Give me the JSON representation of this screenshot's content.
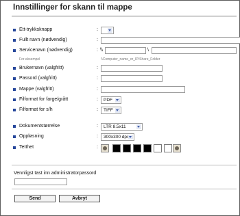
{
  "page": {
    "title": "Innstillinger for skann til mappe"
  },
  "fields": {
    "quick_key": {
      "label": "Ett-trykksknapp",
      "value": ""
    },
    "full_name": {
      "label": "Fullt navn (nødvendig)",
      "value": ""
    },
    "service_name": {
      "label": "Servicenavn (nødvendig)",
      "prefix": "\\\\",
      "separator": "\\",
      "example_label": "For eksempel",
      "example": "\\\\Computer_name_or_IP\\Share_Folder"
    },
    "username": {
      "label": "Brukernavn (valgfritt)",
      "value": ""
    },
    "password": {
      "label": "Passord (valgfritt)",
      "value": ""
    },
    "folder": {
      "label": "Mappe (valgfritt)",
      "value": ""
    },
    "color_format": {
      "label": "Filformat for farge/grått",
      "value": "PDF"
    },
    "bw_format": {
      "label": "Filformat for s/h",
      "value": "TIFF"
    },
    "doc_size": {
      "label": "Dokumentstørrelse",
      "value": "LTR 8.5x11"
    },
    "resolution": {
      "label": "Oppløsning",
      "value": "300x300 dpi"
    },
    "density": {
      "label": "Tetthet",
      "levels": [
        "#000000",
        "#000000",
        "#000000",
        "#000000",
        "#ffffff",
        "#ffffff"
      ]
    }
  },
  "admin": {
    "prompt": "Vennligst tast inn administratorpassord",
    "value": ""
  },
  "buttons": {
    "send": "Send",
    "cancel": "Avbryt"
  },
  "colors": {
    "bullet": "#26479b"
  }
}
